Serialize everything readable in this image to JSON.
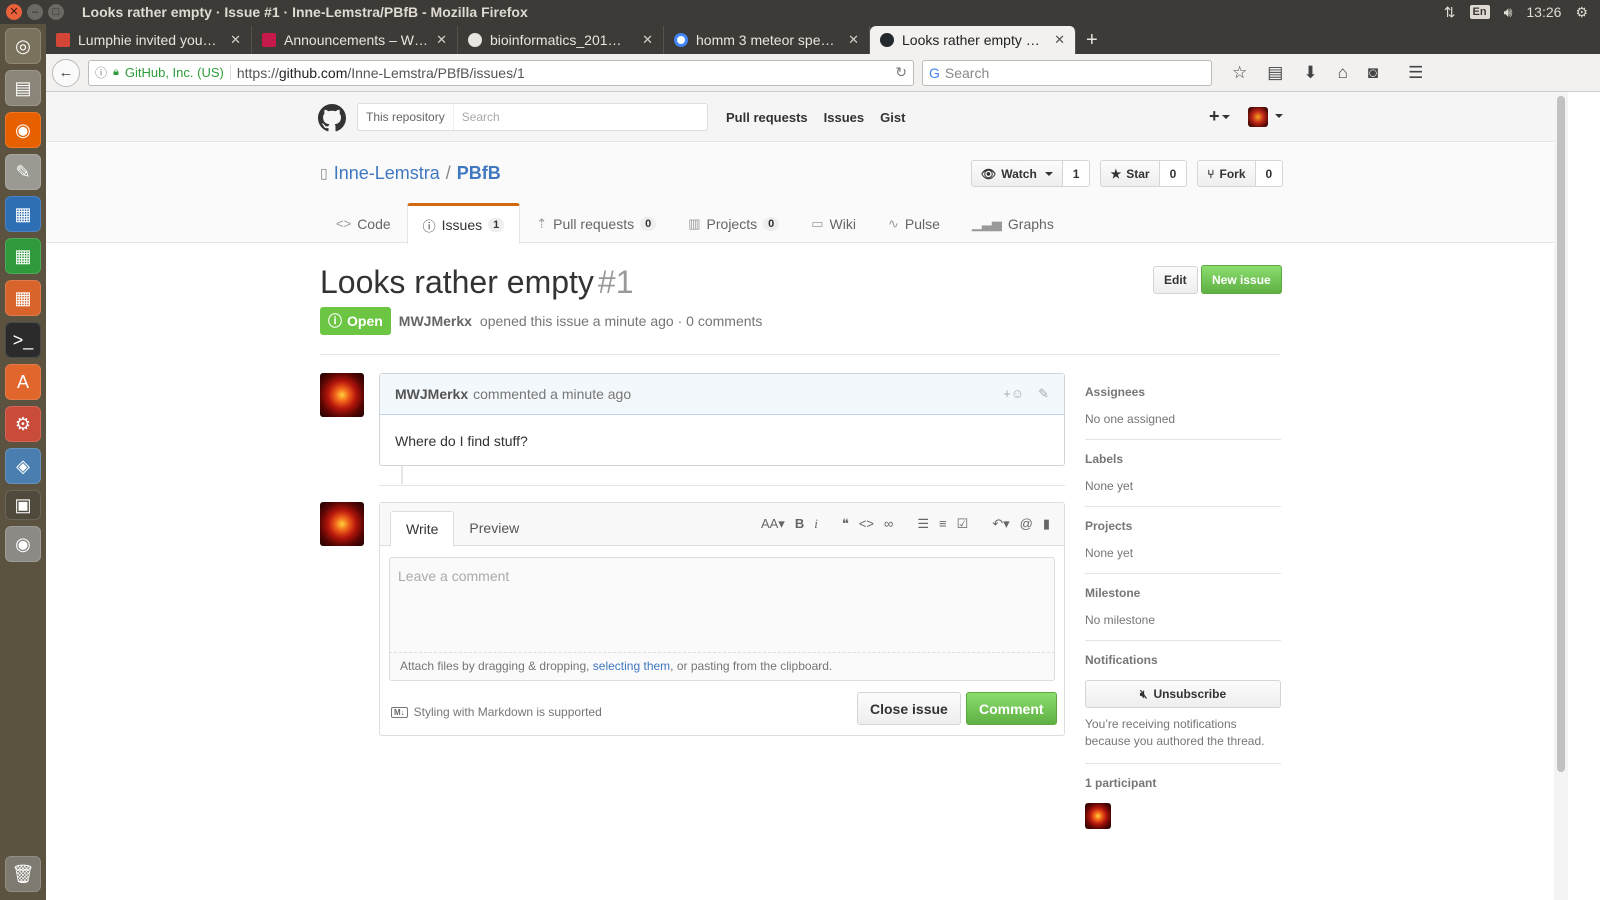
{
  "os": {
    "window_title": "Looks rather empty · Issue #1 · Inne-Lemstra/PBfB - Mozilla Firefox",
    "keyboard_layout": "En",
    "clock": "13:26"
  },
  "browser": {
    "tabs": [
      {
        "label": "Lumphie invited you…",
        "icon": "gmail-icon",
        "color": "#d44638"
      },
      {
        "label": "Announcements – W…",
        "icon": "raspberry-icon",
        "color": "#c51a4a"
      },
      {
        "label": "bioinformatics_201…",
        "icon": "github-icon",
        "color": "#24292e"
      },
      {
        "label": "homm 3 meteor spe…",
        "icon": "google-icon",
        "color": "#4285f4"
      },
      {
        "label": "Looks rather empty …",
        "icon": "github-icon",
        "color": "#24292e"
      }
    ],
    "identity": "GitHub, Inc. (US)",
    "url_scheme": "https://",
    "url_host": "github.com",
    "url_path": "/Inne-Lemstra/PBfB/issues/1",
    "search_placeholder": "Search"
  },
  "github": {
    "search_scope": "This repository",
    "search_placeholder": "Search",
    "header_nav": [
      "Pull requests",
      "Issues",
      "Gist"
    ],
    "repo_owner": "Inne-Lemstra",
    "repo_separator": "/",
    "repo_name": "PBfB",
    "watch": {
      "label": "Watch",
      "count": "1"
    },
    "star": {
      "label": "Star",
      "count": "0"
    },
    "fork": {
      "label": "Fork",
      "count": "0"
    },
    "reponav": {
      "code": "Code",
      "issues": "Issues",
      "issues_count": "1",
      "pulls": "Pull requests",
      "pulls_count": "0",
      "projects": "Projects",
      "projects_count": "0",
      "wiki": "Wiki",
      "pulse": "Pulse",
      "graphs": "Graphs"
    }
  },
  "issue": {
    "title": "Looks rather empty",
    "number": "#1",
    "edit_label": "Edit",
    "new_issue_label": "New issue",
    "state": "Open",
    "author": "MWJMerkx",
    "meta_text": "opened this issue a minute ago · 0 comments"
  },
  "comment": {
    "author": "MWJMerkx",
    "meta": "commented a minute ago",
    "body": "Where do I find stuff?"
  },
  "form": {
    "tab_write": "Write",
    "tab_preview": "Preview",
    "placeholder": "Leave a comment",
    "attach_prefix": "Attach files by dragging & dropping, ",
    "attach_link": "selecting them",
    "attach_suffix": ", or pasting from the clipboard.",
    "markdown_note": "Styling with Markdown is supported",
    "close_label": "Close issue",
    "comment_label": "Comment"
  },
  "sidebar": {
    "assignees_title": "Assignees",
    "assignees_value": "No one assigned",
    "labels_title": "Labels",
    "labels_value": "None yet",
    "projects_title": "Projects",
    "projects_value": "None yet",
    "milestone_title": "Milestone",
    "milestone_value": "No milestone",
    "notifications_title": "Notifications",
    "unsubscribe_label": "Unsubscribe",
    "notifications_note": "You’re receiving notifications because you authored the thread.",
    "participants_title": "1 participant"
  },
  "colors": {
    "open_green": "#6cc644",
    "link_blue": "#4078c0",
    "tab_accent": "#d26911"
  }
}
